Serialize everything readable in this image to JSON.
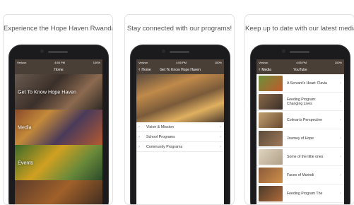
{
  "cards": [
    {
      "caption": "Experience the Hope Haven Rwanda App!",
      "status": {
        "carrier": "Verizon",
        "time": "4:55 PM",
        "battery": "100%"
      },
      "nav": {
        "title": "Home"
      },
      "tiles": [
        {
          "label": "Get To Know Hope Haven"
        },
        {
          "label": "Media"
        },
        {
          "label": "Events"
        },
        {
          "label": ""
        }
      ]
    },
    {
      "caption": "Stay connected with our programs!",
      "status": {
        "carrier": "Verizon",
        "time": "4:55 PM",
        "battery": "100%"
      },
      "nav": {
        "back": "Home",
        "title": "Get To Know Hope Haven"
      },
      "menu": [
        "Vision & Mission",
        "School Programs",
        "Community Programs"
      ]
    },
    {
      "caption": "Keep up to date with our latest media!",
      "status": {
        "carrier": "Verizon",
        "time": "4:55 PM",
        "battery": "100%"
      },
      "nav": {
        "back": "Media",
        "title": "YouTube"
      },
      "videos": [
        "A Servant's Heart: Flavia",
        "Feeding Program: Changing Lives",
        "Colman's Perspective",
        "Journey of Hope",
        "Some of the little ones",
        "Faces of Murindi",
        "Feeding Program The"
      ]
    }
  ],
  "icons": {
    "back": "chevron-left-icon",
    "menu_arrow": "arrow-right-icon",
    "row_chevron": "chevron-right-icon"
  }
}
